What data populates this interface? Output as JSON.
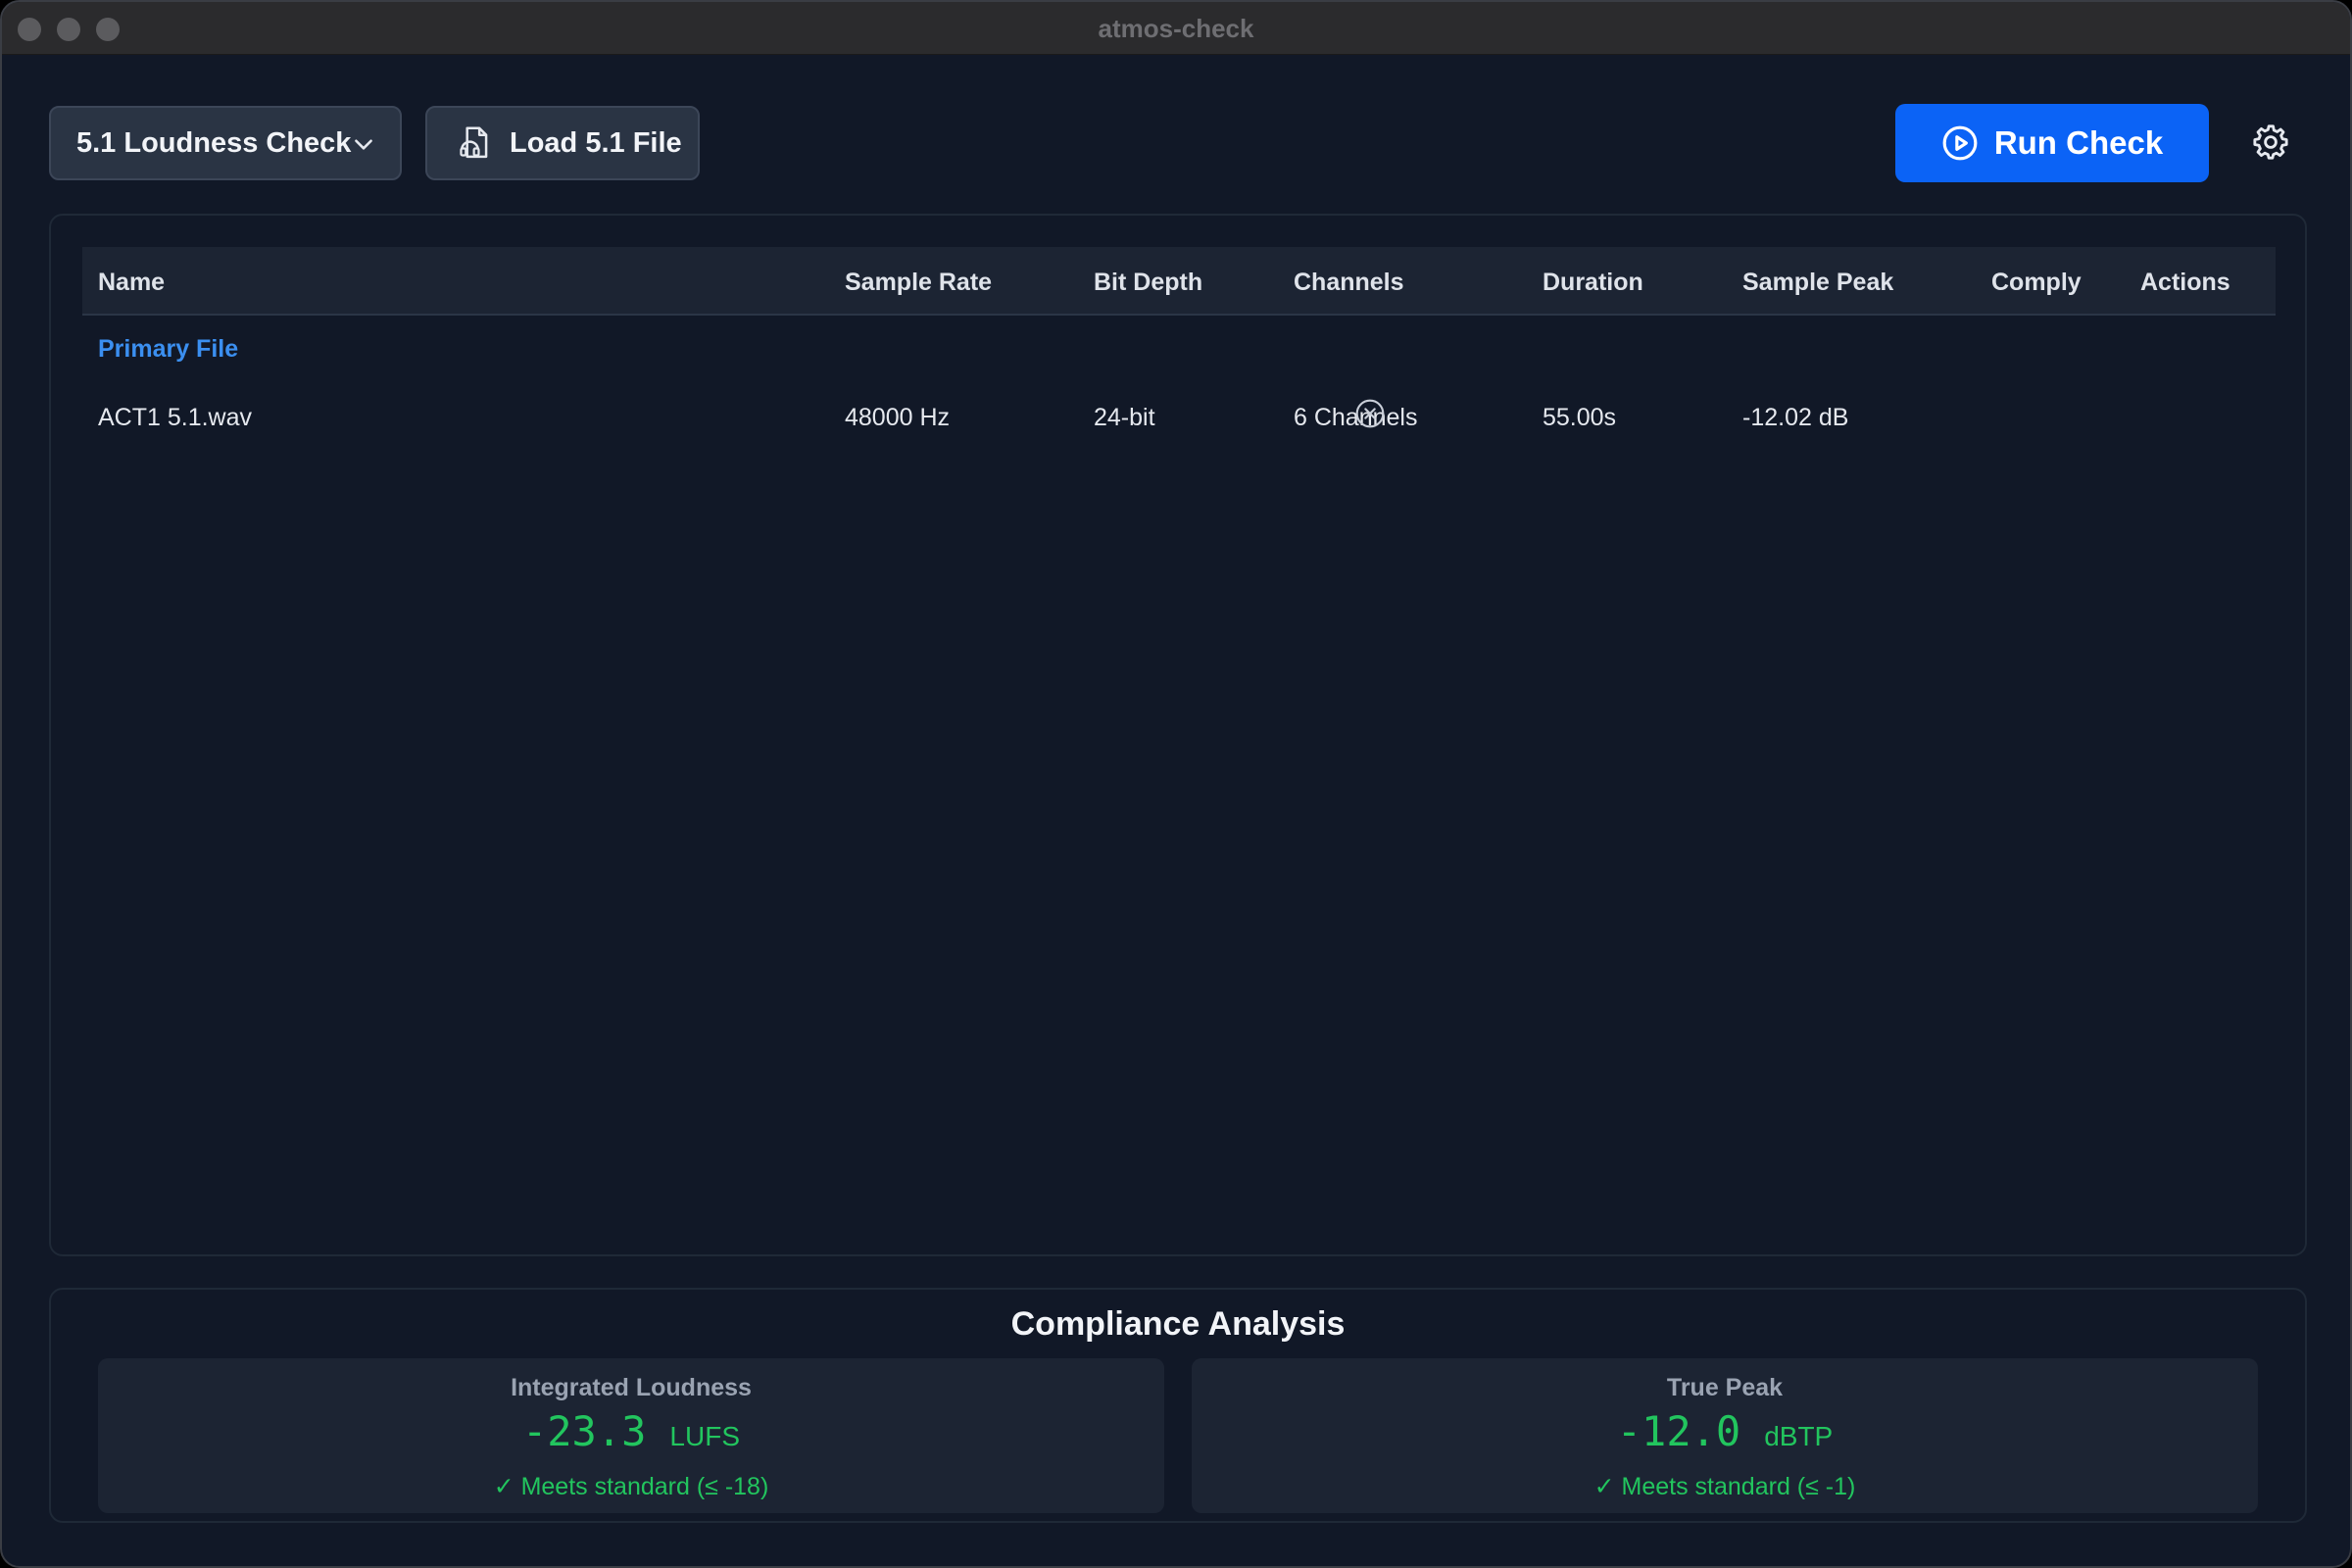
{
  "window": {
    "title": "atmos-check"
  },
  "toolbar": {
    "preset_label": "5.1 Loudness Check",
    "load_label": "Load 5.1 File",
    "run_label": "Run Check"
  },
  "table": {
    "columns": [
      "Name",
      "Sample Rate",
      "Bit Depth",
      "Channels",
      "Duration",
      "Sample Peak",
      "Comply",
      "Actions"
    ],
    "group_label": "Primary File",
    "rows": [
      {
        "name": "ACT1 5.1.wav",
        "sample_rate": "48000 Hz",
        "bit_depth": "24-bit",
        "channels": "6 Channels",
        "duration": "55.00s",
        "sample_peak": "-12.02 dB",
        "comply": ""
      }
    ]
  },
  "compliance": {
    "title": "Compliance Analysis",
    "integrated": {
      "label": "Integrated Loudness",
      "value": "-23.3",
      "unit": "LUFS",
      "status": "✓ Meets standard (≤ -18)"
    },
    "true_peak": {
      "label": "True Peak",
      "value": "-12.0",
      "unit": "dBTP",
      "status": "✓ Meets standard (≤ -1)"
    }
  },
  "colors": {
    "accent": "#0b63f6",
    "pass": "#22c55e",
    "group_label": "#3b8ff0",
    "background": "#111827"
  },
  "icons": [
    "chevron-down-icon",
    "file-audio-icon",
    "play-circle-icon",
    "gear-icon",
    "remove-circle-icon"
  ]
}
